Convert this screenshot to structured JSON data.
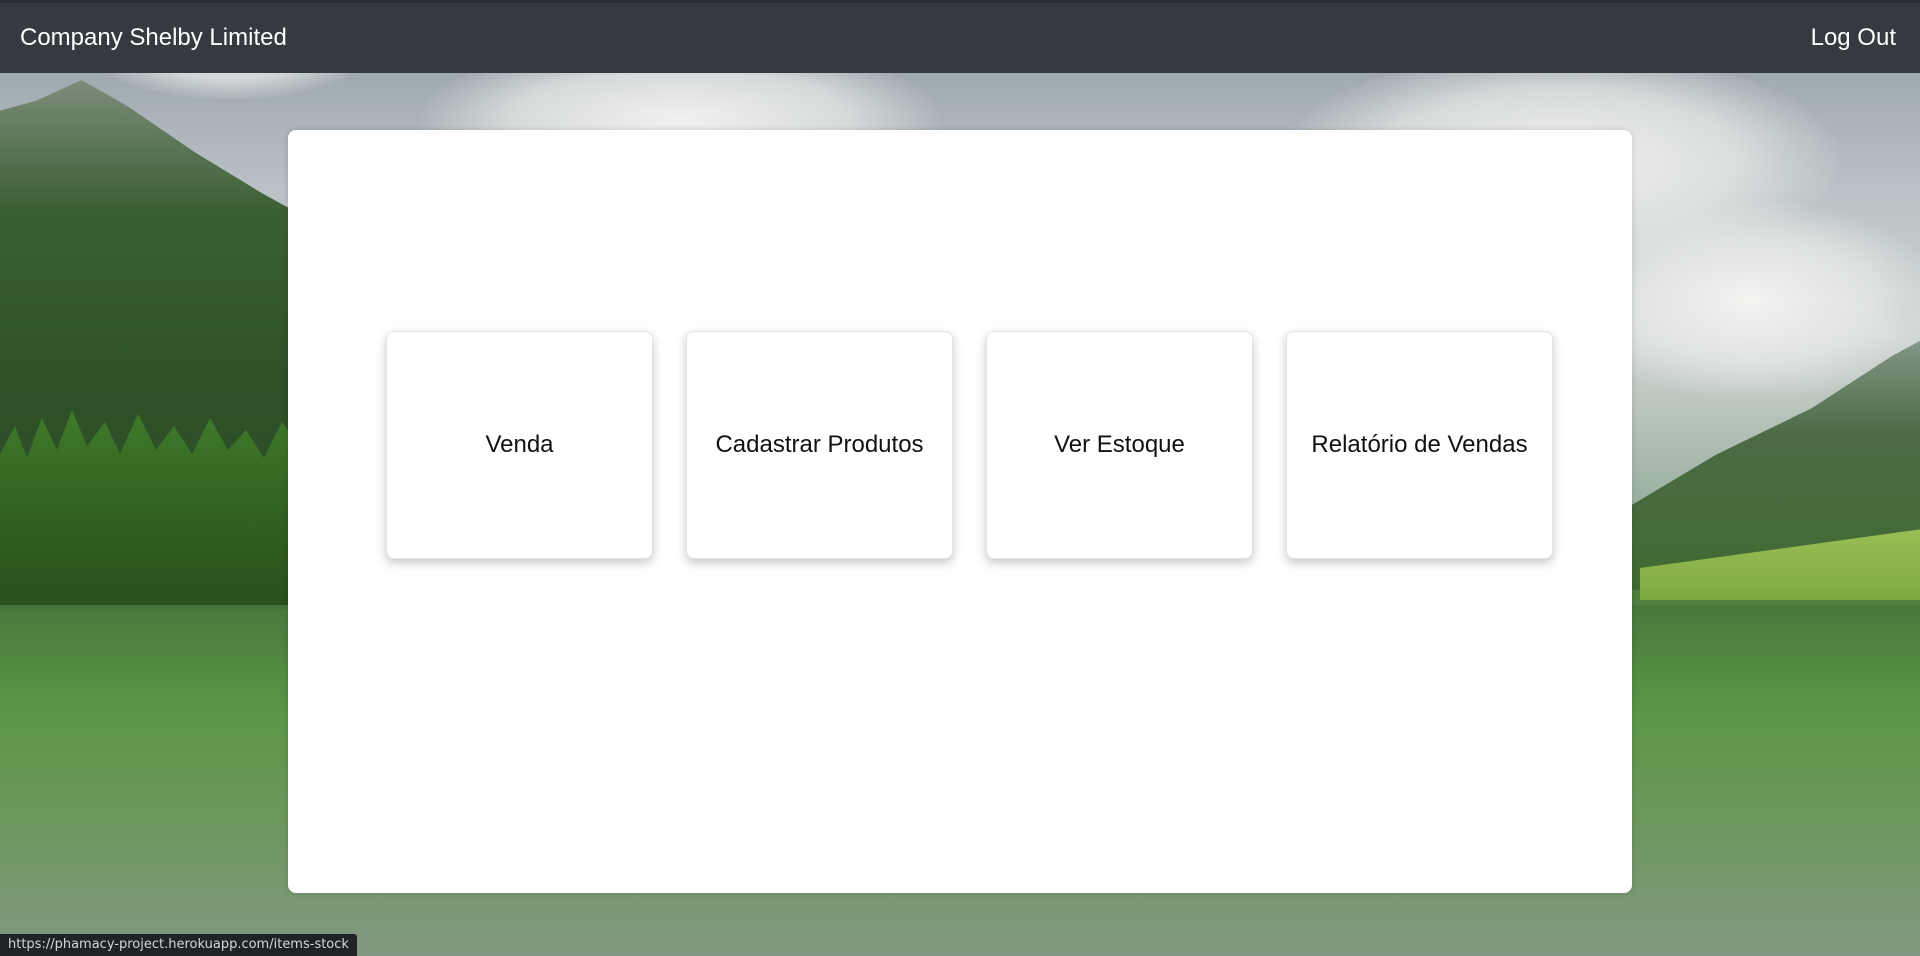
{
  "navbar": {
    "brand": "Company Shelby Limited",
    "logout_label": "Log Out",
    "background": "#343a40"
  },
  "menu": {
    "cards": [
      {
        "label": "Venda"
      },
      {
        "label": "Cadastrar Produtos"
      },
      {
        "label": "Ver Estoque"
      },
      {
        "label": "Relatório de Vendas"
      }
    ]
  },
  "status_bar": {
    "url": "https://phamacy-project.herokuapp.com/items-stock"
  }
}
